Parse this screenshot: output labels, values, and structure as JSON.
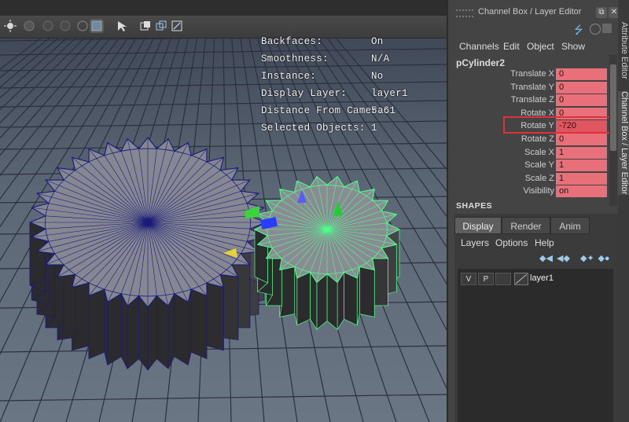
{
  "hud": {
    "rows": [
      {
        "label": "Backfaces:",
        "value": "On"
      },
      {
        "label": "Smoothness:",
        "value": "N/A"
      },
      {
        "label": "Instance:",
        "value": "No"
      },
      {
        "label": "Display Layer:",
        "value": "layer1"
      },
      {
        "label": "Distance From Camera:",
        "value": "5.61"
      },
      {
        "label": "Selected Objects:",
        "value": "1"
      }
    ]
  },
  "panel": {
    "title": "Channel Box / Layer Editor",
    "menu": [
      "Channels",
      "Edit",
      "Object",
      "Show"
    ],
    "object_name": "pCylinder2",
    "channels": [
      {
        "label": "Translate X",
        "value": "0"
      },
      {
        "label": "Translate Y",
        "value": "0"
      },
      {
        "label": "Translate Z",
        "value": "0"
      },
      {
        "label": "Rotate X",
        "value": "0"
      },
      {
        "label": "Rotate Y",
        "value": "-720"
      },
      {
        "label": "Rotate Z",
        "value": "0"
      },
      {
        "label": "Scale X",
        "value": "1"
      },
      {
        "label": "Scale Y",
        "value": "1"
      },
      {
        "label": "Scale Z",
        "value": "1"
      },
      {
        "label": "Visibility",
        "value": "on"
      }
    ],
    "shapes_label": "SHAPES"
  },
  "layer_editor": {
    "tabs": [
      "Display",
      "Render",
      "Anim"
    ],
    "active_tab": "Display",
    "menu": [
      "Layers",
      "Options",
      "Help"
    ],
    "layer": {
      "v": "V",
      "p": "P",
      "name": "layer1"
    }
  },
  "side_tabs": {
    "attribute_editor": "Attribute Editor",
    "channel_box": "Channel Box / Layer Editor"
  },
  "colors": {
    "channel_value_bg": "#e8707a",
    "highlight": "#e0303a",
    "selected_wireframe": "#4dff8a",
    "unselected_wireframe": "#1a1a8a"
  }
}
